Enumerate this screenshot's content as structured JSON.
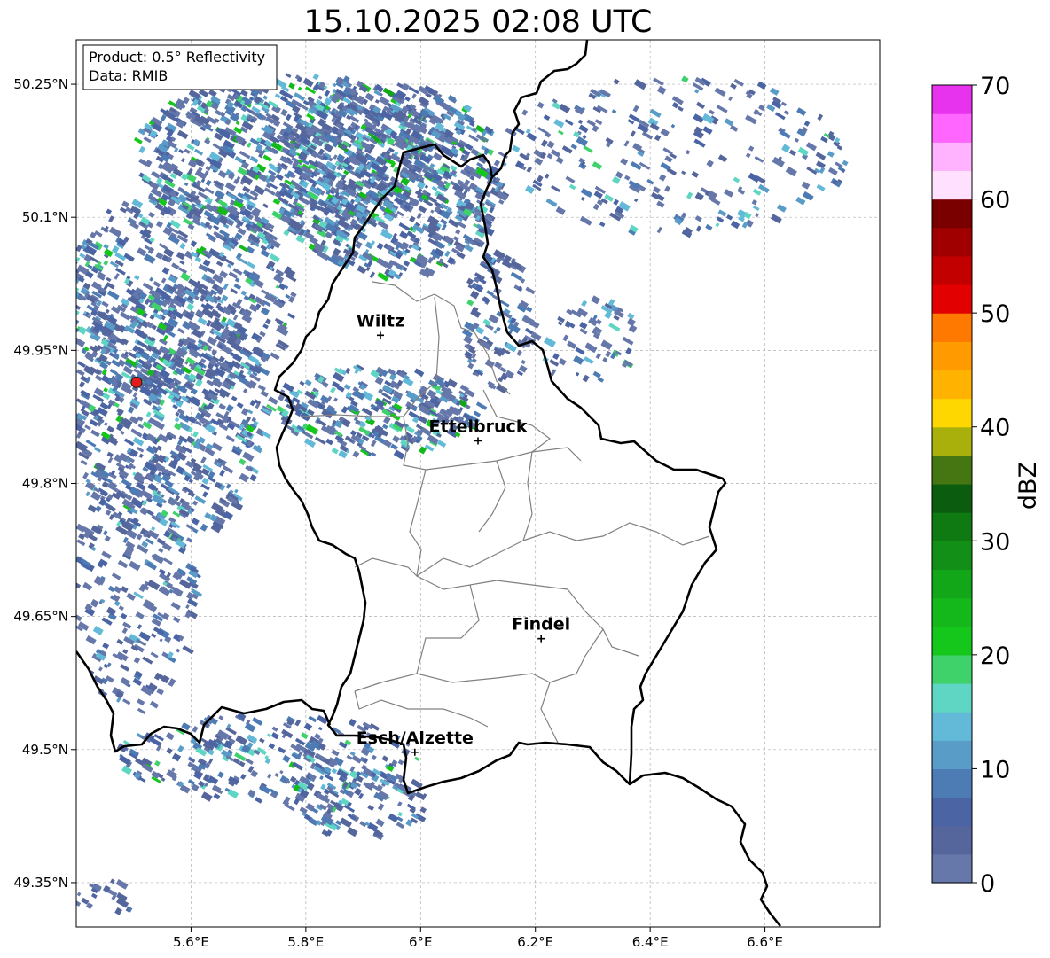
{
  "title": "15.10.2025 02:08 UTC",
  "info_box": {
    "line1": "Product: 0.5° Reflectivity",
    "line2": "Data: RMIB"
  },
  "axes": {
    "lon_ticks": [
      {
        "value": 5.6,
        "label": "5.6°E"
      },
      {
        "value": 5.8,
        "label": "5.8°E"
      },
      {
        "value": 6.0,
        "label": "6°E"
      },
      {
        "value": 6.2,
        "label": "6.2°E"
      },
      {
        "value": 6.4,
        "label": "6.4°E"
      },
      {
        "value": 6.6,
        "label": "6.6°E"
      }
    ],
    "lat_ticks": [
      {
        "value": 50.25,
        "label": "50.25°N"
      },
      {
        "value": 50.1,
        "label": "50.1°N"
      },
      {
        "value": 49.95,
        "label": "49.95°N"
      },
      {
        "value": 49.8,
        "label": "49.8°N"
      },
      {
        "value": 49.65,
        "label": "49.65°N"
      },
      {
        "value": 49.5,
        "label": "49.5°N"
      },
      {
        "value": 49.35,
        "label": "49.35°N"
      }
    ],
    "lon_range": [
      5.4,
      6.8
    ],
    "lat_range": [
      49.3,
      50.3
    ],
    "grid": true
  },
  "cities": [
    {
      "name": "Wiltz",
      "lon": 5.93,
      "lat": 49.967
    },
    {
      "name": "Ettelbruck",
      "lon": 6.1,
      "lat": 49.848
    },
    {
      "name": "Findel",
      "lon": 6.21,
      "lat": 49.625
    },
    {
      "name": "Esch/Alzette",
      "lon": 5.99,
      "lat": 49.497
    }
  ],
  "radar_site": {
    "lon": 5.505,
    "lat": 49.914,
    "color": "#e41a1c"
  },
  "colorbar": {
    "label": "dBZ",
    "min": 0,
    "max": 70,
    "tick_labels": [
      "0",
      "10",
      "20",
      "30",
      "40",
      "50",
      "60",
      "70"
    ],
    "colors": [
      "#6677aa",
      "#55669c",
      "#4a64a4",
      "#4d7bb4",
      "#5a9cc8",
      "#62b9d8",
      "#5fd6c3",
      "#3fd16a",
      "#16c71b",
      "#14b81a",
      "#12a619",
      "#128f16",
      "#0f7a12",
      "#0b5c0e",
      "#467612",
      "#a9af0b",
      "#ffd700",
      "#ffb300",
      "#ff9b00",
      "#ff7800",
      "#e20000",
      "#c30000",
      "#a00000",
      "#7a0000",
      "#ffe0ff",
      "#ffb3ff",
      "#ff66ff",
      "#e833ee"
    ]
  }
}
